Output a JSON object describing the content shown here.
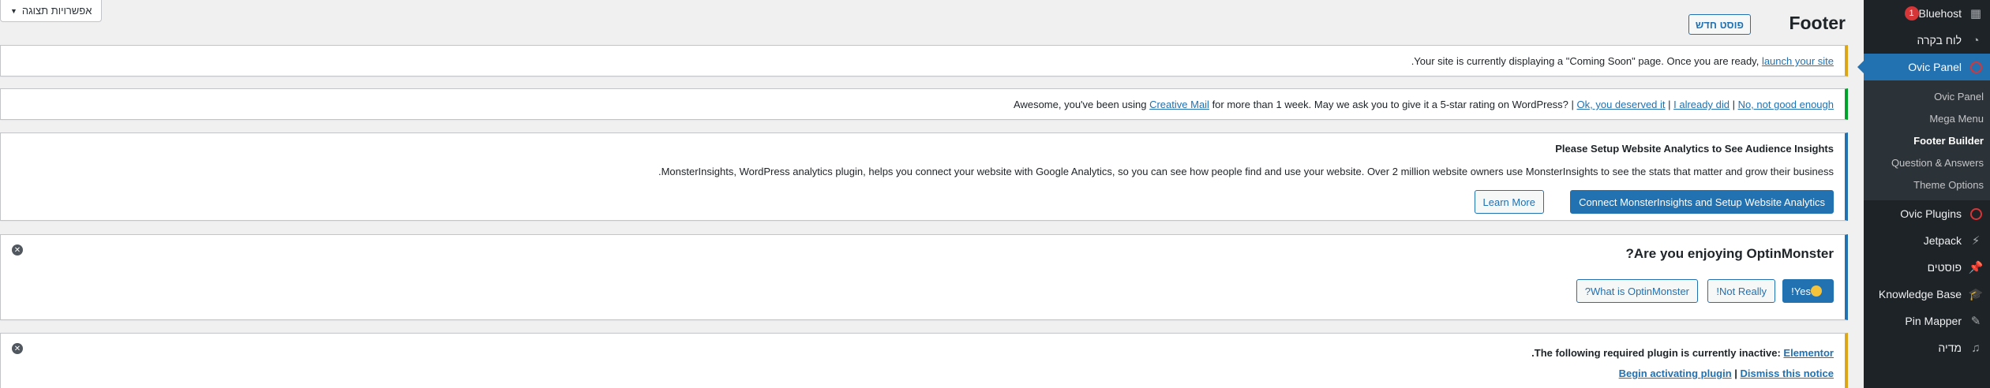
{
  "screen_options": {
    "label": "אפשרויות תצוגה",
    "arrow": "▼"
  },
  "header": {
    "title": "Footer",
    "add_new": "פוסט חדש"
  },
  "sidebar": {
    "items": [
      {
        "label": "Bluehost",
        "icon": "grid-icon",
        "badge": "1"
      },
      {
        "label": "לוח בקרה",
        "icon": "dashboard-icon"
      },
      {
        "label": "Ovic Panel",
        "icon": "ovic-panel-icon",
        "current": true
      },
      {
        "label": "Ovic Plugins",
        "icon": "ovic-plugins-icon"
      },
      {
        "label": "Jetpack",
        "icon": "jetpack-icon"
      },
      {
        "label": "פוסטים",
        "icon": "pin-icon"
      },
      {
        "label": "Knowledge Base",
        "icon": "education-icon"
      },
      {
        "label": "Pin Mapper",
        "icon": "edit-icon"
      },
      {
        "label": "מדיה",
        "icon": "media-icon"
      }
    ],
    "submenu": [
      {
        "label": "Ovic Panel"
      },
      {
        "label": "Mega Menu"
      },
      {
        "label": "Footer Builder",
        "current": true
      },
      {
        "label": "Question & Answers"
      },
      {
        "label": "Theme Options"
      }
    ]
  },
  "notices": {
    "coming_soon": {
      "text": ".Your site is currently displaying a \"Coming Soon\" page. Once you are ready, ",
      "link": "launch your site"
    },
    "creative_mail": {
      "prefix": "Awesome, you've been using ",
      "link_product": "Creative Mail",
      "middle": " for more than 1 week. May we ask you to give it a 5-star rating on WordPress? | ",
      "link_ok": "Ok, you deserved it",
      "sep1": " | ",
      "link_did": "I already did",
      "sep2": " | ",
      "link_no": "No, not good enough"
    },
    "monsterinsights": {
      "title": "Please Setup Website Analytics to See Audience Insights",
      "body": ".MonsterInsights, WordPress analytics plugin, helps you connect your website with Google Analytics, so you can see how people find and use your website. Over 2 million website owners use MonsterInsights to see the stats that matter and grow their business",
      "primary_button": "Connect MonsterInsights and Setup Website Analytics",
      "secondary_button": "Learn More"
    },
    "optinmonster": {
      "title": "?Are you enjoying OptinMonster",
      "yes": "!Yes",
      "not_really": "!Not Really",
      "what_is": "?What is OptinMonster"
    },
    "elementor": {
      "text": ".The following required plugin is currently inactive: ",
      "plugin_link": "Elementor",
      "begin": "Begin activating plugin",
      "sep": " | ",
      "dismiss": "Dismiss this notice"
    }
  },
  "colors": {
    "accent": "#2271b1",
    "warning": "#dba617",
    "success": "#00a32a",
    "error": "#d63638",
    "sidebar": "#1d2327"
  }
}
